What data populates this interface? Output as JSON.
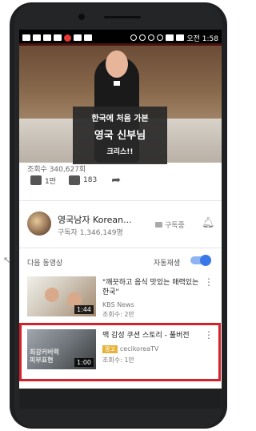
{
  "status_bar": {
    "time": "오전 1:58"
  },
  "video": {
    "caption_line1": "한국에 처음 가본",
    "caption_line2": "영국 신부님",
    "caption_line3": "크리스!!"
  },
  "stats": {
    "views": "조회수 340,627회",
    "likes": "1만",
    "dislikes": "183"
  },
  "channel": {
    "name": "영국남자 Korean...",
    "subscribers": "구독자 1,346,149명",
    "subscribed_label": "구독중"
  },
  "up_next": {
    "label": "다음 동영상",
    "autoplay_label": "자동재생",
    "autoplay_on": true
  },
  "items": [
    {
      "title": "\"깨끗하고 음식 맛있는 매력있는 한국\"",
      "channel": "KBS News",
      "views": "조회수: 2만",
      "duration": "1:44"
    },
    {
      "title": "맥 감성 쿠션 스토리 - 풀버전",
      "ad_label": "광고",
      "channel": "cecikoreaTV",
      "views": "조회수: 1만",
      "duration": "1:00",
      "thumb_text": "최강커버력\n피부표현"
    }
  ],
  "colors": {
    "highlight": "#d5212b",
    "toggle": "#3b78e7"
  }
}
